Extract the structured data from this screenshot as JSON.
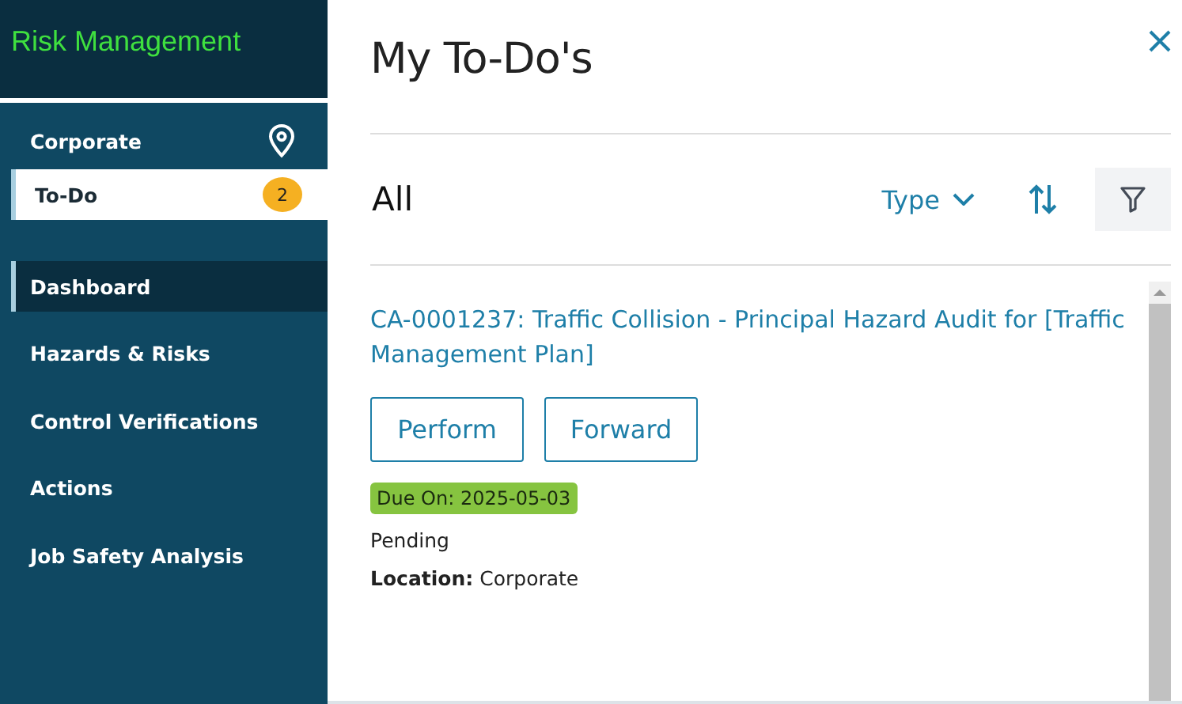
{
  "app": {
    "title": "Risk Management"
  },
  "location": {
    "label": "Corporate"
  },
  "todo": {
    "label": "To-Do",
    "count": "2",
    "selected": true
  },
  "nav": [
    {
      "label": "Dashboard",
      "selected": true
    },
    {
      "label": "Hazards & Risks",
      "selected": false
    },
    {
      "label": "Control Verifications",
      "selected": false
    },
    {
      "label": "Actions",
      "selected": false
    },
    {
      "label": "Job Safety Analysis",
      "selected": false
    }
  ],
  "panel": {
    "title": "My To-Do's",
    "filter_label": "All",
    "type_label": "Type"
  },
  "items": [
    {
      "title": "CA-0001237: Traffic Collision - Principal Hazard Audit for [Traffic Management Plan]",
      "buttons": [
        "Perform",
        "Forward"
      ],
      "due": "Due On: 2025-05-03",
      "status": "Pending",
      "location_label": "Location:",
      "location": "Corporate"
    }
  ]
}
